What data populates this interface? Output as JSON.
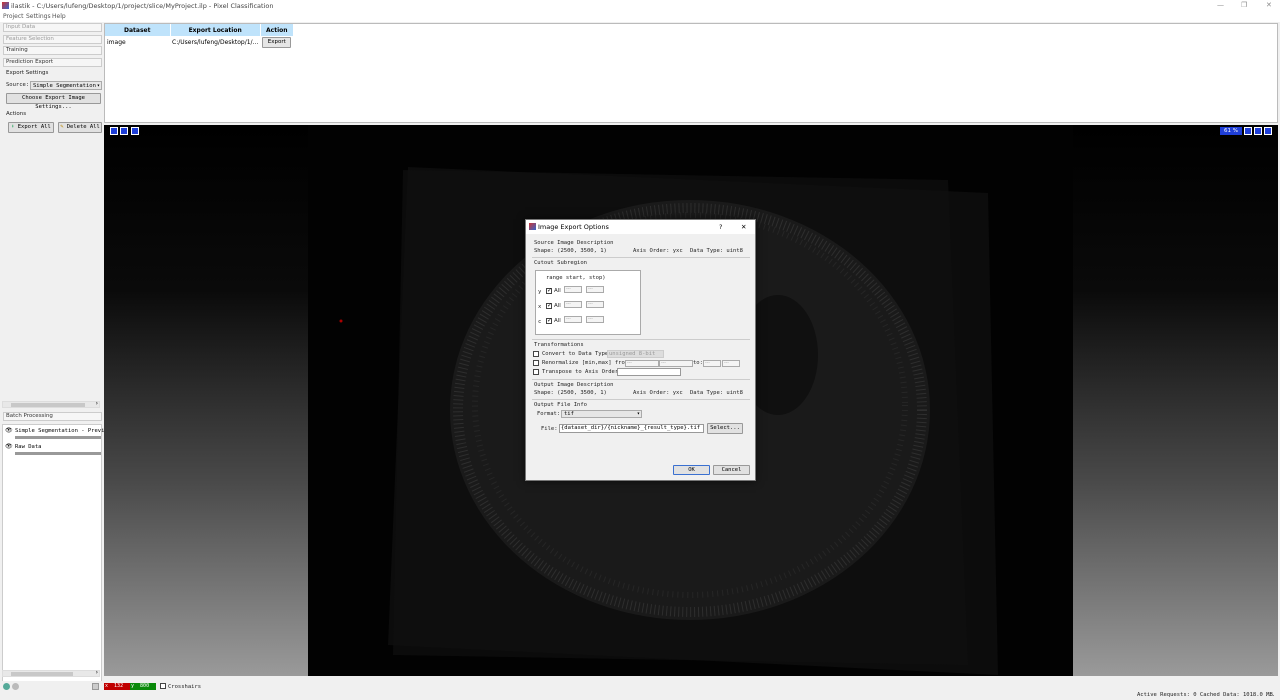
{
  "window": {
    "title": "ilastik - C:/Users/lufeng/Desktop/1/project/slice/MyProject.ilp - Pixel Classification"
  },
  "menu": [
    "Project",
    "Settings",
    "Help"
  ],
  "applets": {
    "input_data": "Input Data",
    "feature_selection": "Feature Selection",
    "training": "Training",
    "prediction_export": "Prediction Export",
    "batch_processing": "Batch Processing"
  },
  "export_settings": {
    "heading": "Export Settings",
    "source_label": "Source:",
    "source_value": "Simple Segmentation",
    "choose_button": "Choose Export Image Settings...",
    "actions_heading": "Actions",
    "export_all": "Export All",
    "delete_all": "Delete All"
  },
  "layers": [
    {
      "name": "Simple Segmentation - Preview"
    },
    {
      "name": "Raw Data"
    }
  ],
  "table": {
    "headers": [
      "Dataset",
      "Export Location",
      "Action"
    ],
    "rows": [
      {
        "dataset": "image",
        "location": "C:/Users/lufeng/Desktop/1/...",
        "action": "Export"
      }
    ]
  },
  "viewer": {
    "zoom": "61 %"
  },
  "dialog": {
    "title": "Image Export Options",
    "help": "?",
    "close": "✕",
    "source_desc": "Source Image Description",
    "source_shape": "Shape: (2500, 3500, 1)",
    "source_axis": "Axis Order: yxc",
    "source_dtype": "Data Type: uint8",
    "cutout": "Cutout Subregion",
    "cutout_header": "range  start, stop)",
    "axes": [
      {
        "axis": "y",
        "all": "All",
        "start": "---",
        "stop": "---"
      },
      {
        "axis": "x",
        "all": "All",
        "start": "---",
        "stop": "---"
      },
      {
        "axis": "c",
        "all": "All",
        "start": "---",
        "stop": "---"
      }
    ],
    "transformations": "Transformations",
    "convert_label": "Convert to Data Type:",
    "convert_value": "unsigned 8-bit",
    "renorm_label": "Renormalize [min,max] from:",
    "renorm_to": "to:",
    "renorm_placeholder": "---",
    "transpose_label": "Transpose to Axis Order:",
    "output_desc": "Output Image Description",
    "output_shape": "Shape: (2500, 3500, 1)",
    "output_axis": "Axis Order: yxc",
    "output_dtype": "Data Type: uint8",
    "file_info": "Output File Info",
    "format_label": "Format:",
    "format_value": "tif",
    "file_label": "File:",
    "file_value": "{dataset_dir}/{nickname}_{result_type}.tif",
    "select_button": "Select...",
    "ok": "OK",
    "cancel": "Cancel"
  },
  "status": {
    "x_label": "x",
    "x_value": "132",
    "y_label": "y",
    "y_value": "800",
    "crosshairs": "Crosshairs",
    "active_requests": "Active Requests: 0 Cached Data: 1018.0 MB"
  },
  "colors": {
    "accent_blue": "#1f3fd8",
    "header_blue": "#bfe3fb",
    "coord_red": "#c00000",
    "coord_green": "#0a8a0a"
  }
}
